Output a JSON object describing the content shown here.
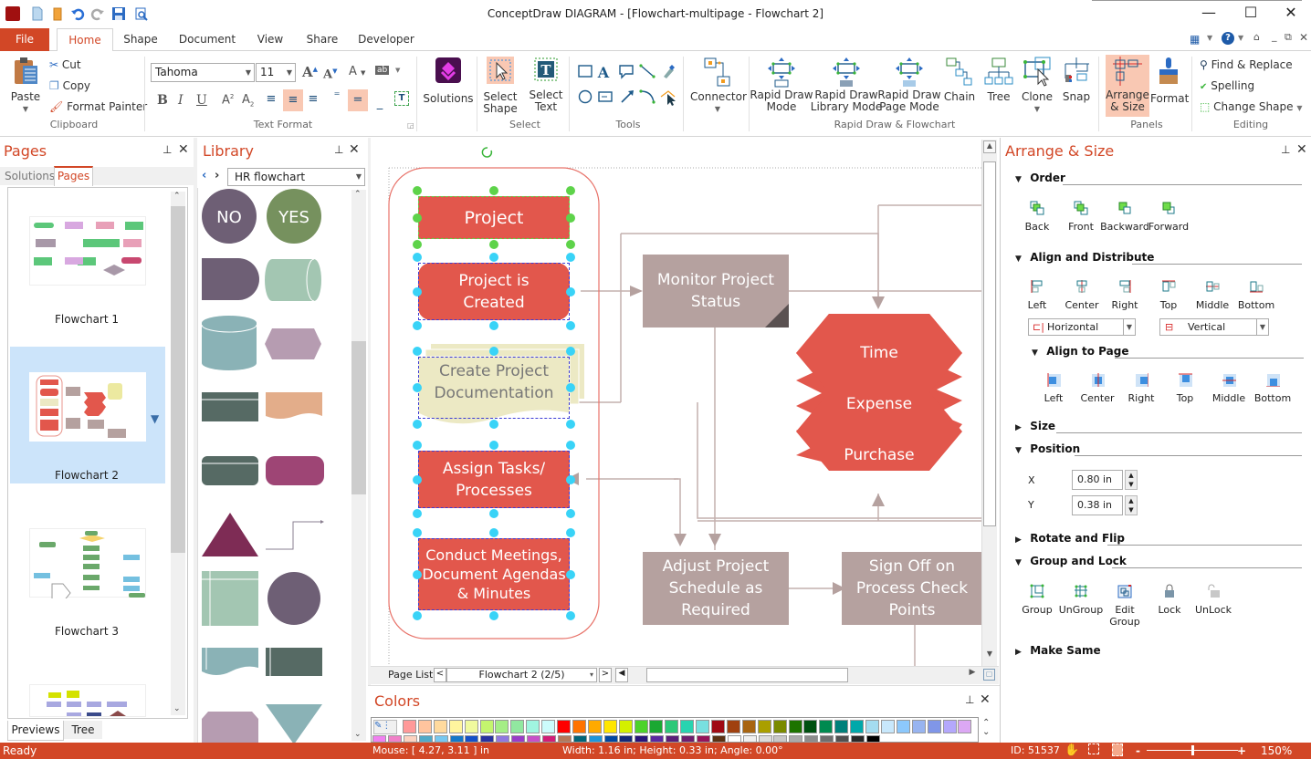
{
  "window": {
    "title": "ConceptDraw DIAGRAM - [Flowchart-multipage - Flowchart 2]",
    "quick_access": [
      "app-icon",
      "new-icon",
      "open-icon",
      "undo-icon",
      "redo-icon",
      "save-icon",
      "print-preview-icon"
    ]
  },
  "tabs": {
    "file": "File",
    "items": [
      "Home",
      "Shape",
      "Document",
      "View",
      "Share",
      "Developer"
    ],
    "active": "Home"
  },
  "ribbon": {
    "clipboard": {
      "paste": "Paste",
      "cut": "Cut",
      "copy": "Copy",
      "format_painter": "Format Painter",
      "label": "Clipboard"
    },
    "text_format": {
      "font": "Tahoma",
      "size": "11",
      "label": "Text Format"
    },
    "solutions": {
      "label": "Solutions"
    },
    "select": {
      "select_shape": "Select Shape",
      "select_text": "Select Text",
      "label": "Select"
    },
    "tools": {
      "label": "Tools"
    },
    "connector": {
      "label": "Connector"
    },
    "rapid": {
      "items": [
        "Rapid Draw Mode",
        "Rapid Draw Library Mode",
        "Rapid Draw Page Mode",
        "Chain",
        "Tree",
        "Clone",
        "Snap"
      ],
      "label": "Rapid Draw & Flowchart"
    },
    "panels": {
      "arrange": "Arrange & Size",
      "format": "Format",
      "label": "Panels"
    },
    "editing": {
      "find": "Find & Replace",
      "spelling": "Spelling",
      "change_shape": "Change Shape",
      "label": "Editing"
    }
  },
  "pages_panel": {
    "title": "Pages",
    "tabs": [
      "Solutions",
      "Pages"
    ],
    "active_tab": "Pages",
    "pages": [
      {
        "name": "Flowchart 1",
        "selected": false
      },
      {
        "name": "Flowchart 2",
        "selected": true
      },
      {
        "name": "Flowchart 3",
        "selected": false
      }
    ],
    "bottom_tabs": [
      "Previews",
      "Tree"
    ],
    "active_bottom_tab": "Previews"
  },
  "library_panel": {
    "title": "Library",
    "selected_library": "HR flowchart",
    "shapes": [
      {
        "name": "NO",
        "color": "#6e5f75"
      },
      {
        "name": "YES",
        "color": "#76915e"
      },
      {
        "name": "delay",
        "color": "#6e5f75"
      },
      {
        "name": "direct-data",
        "color": "#a3c6b2"
      },
      {
        "name": "database",
        "color": "#8ab2b6"
      },
      {
        "name": "display",
        "color": "#b69cb1"
      },
      {
        "name": "predefined",
        "color": "#566a64"
      },
      {
        "name": "document",
        "color": "#e3ad8a"
      },
      {
        "name": "predefined-rounded",
        "color": "#566a64"
      },
      {
        "name": "terminator",
        "color": "#9e4575"
      },
      {
        "name": "triangle",
        "color": "#7e2c55"
      },
      {
        "name": "connector-line",
        "color": "#8a7f90"
      },
      {
        "name": "internal-storage",
        "color": "#a3c6b2"
      },
      {
        "name": "circle",
        "color": "#6e5f75"
      },
      {
        "name": "paper-tape",
        "color": "#8ab2b6"
      },
      {
        "name": "process",
        "color": "#566a64"
      },
      {
        "name": "loop-limit",
        "color": "#b69cb1"
      },
      {
        "name": "merge",
        "color": "#8ab2b6"
      }
    ]
  },
  "diagram": {
    "shapes": {
      "project": "Project",
      "project_created": "Project is Created",
      "create_docs": "Create Project Documentation",
      "assign": "Assign Tasks/ Processes",
      "meetings": "Conduct Meetings, Document Agendas & Minutes",
      "monitor": "Monitor Project Status",
      "time": "Time",
      "expense": "Expense",
      "purchase": "Purchase",
      "adjust": "Adjust Project Schedule as Required",
      "signoff": "Sign Off on Process Check Points"
    },
    "colors": {
      "red": "#e2574c",
      "mauve": "#b5a19f",
      "doc": "#ece9c4"
    }
  },
  "page_list": {
    "label": "Page List",
    "current": "Flowchart 2 (2/5)"
  },
  "colors_panel": {
    "title": "Colors",
    "row1": [
      "#ff9999",
      "#ffc49e",
      "#ffda9e",
      "#fff59e",
      "#f0fa9e",
      "#c4f56e",
      "#a5ee86",
      "#91e8a0",
      "#a0f5e0",
      "#ccfcfc",
      "#ff0000",
      "#ff7300",
      "#ffaa00",
      "#ffe600",
      "#d4f000",
      "#4dd22a",
      "#1aa832",
      "#2cc878",
      "#28d4b0",
      "#78e0e0",
      "#a00a14",
      "#a0410f",
      "#a86410",
      "#aa9f00",
      "#7a8a00",
      "#1d7300",
      "#005010",
      "#008a50",
      "#00807a",
      "#00a8aa",
      "#a4dcf0",
      "#c8e8fc",
      "#8cc8fc",
      "#98b4f0",
      "#8096e8",
      "#b4a8fc",
      "#dca8f4"
    ],
    "row2": [
      "#f080f0",
      "#f080c8",
      "#fcd2c0",
      "#50aac8",
      "#78c8f0",
      "#1478c8",
      "#1450c8",
      "#2832a0",
      "#9078e0",
      "#9a3cc8",
      "#c850c8",
      "#d21e78",
      "#b4785a",
      "#006478",
      "#1e96dc",
      "#0046a0",
      "#142878",
      "#28147a",
      "#5a28a0",
      "#5a1e78",
      "#6e1e6e",
      "#96145a",
      "#5a3214",
      "#ffffff",
      "#f0f0f0",
      "#dcdcdc",
      "#c8c8c8",
      "#aaaaaa",
      "#8c8c8c",
      "#6e6e6e",
      "#505050",
      "#282828",
      "#000000"
    ]
  },
  "arrange_panel": {
    "title": "Arrange & Size",
    "order": {
      "title": "Order",
      "buttons": [
        "Back",
        "Front",
        "Backward",
        "Forward"
      ]
    },
    "align": {
      "title": "Align and Distribute",
      "buttons": [
        "Left",
        "Center",
        "Right",
        "Top",
        "Middle",
        "Bottom"
      ],
      "horizontal": "Horizontal",
      "vertical": "Vertical"
    },
    "align_page": {
      "title": "Align to Page",
      "buttons": [
        "Left",
        "Center",
        "Right",
        "Top",
        "Middle",
        "Bottom"
      ]
    },
    "size": {
      "title": "Size"
    },
    "position": {
      "title": "Position",
      "x_label": "X",
      "x_value": "0.80 in",
      "y_label": "Y",
      "y_value": "0.38 in"
    },
    "rotate": {
      "title": "Rotate and Flip"
    },
    "group": {
      "title": "Group and Lock",
      "buttons": [
        "Group",
        "UnGroup",
        "Edit Group",
        "Lock",
        "UnLock"
      ]
    },
    "make_same": {
      "title": "Make Same"
    }
  },
  "status": {
    "ready": "Ready",
    "mouse": "Mouse: [ 4.27, 3.11 ] in",
    "dims": "Width: 1.16 in;  Height: 0.33 in;  Angle: 0.00°",
    "id": "ID: 51537",
    "zoom": "150%",
    "zoom_fraction": 0.5
  }
}
